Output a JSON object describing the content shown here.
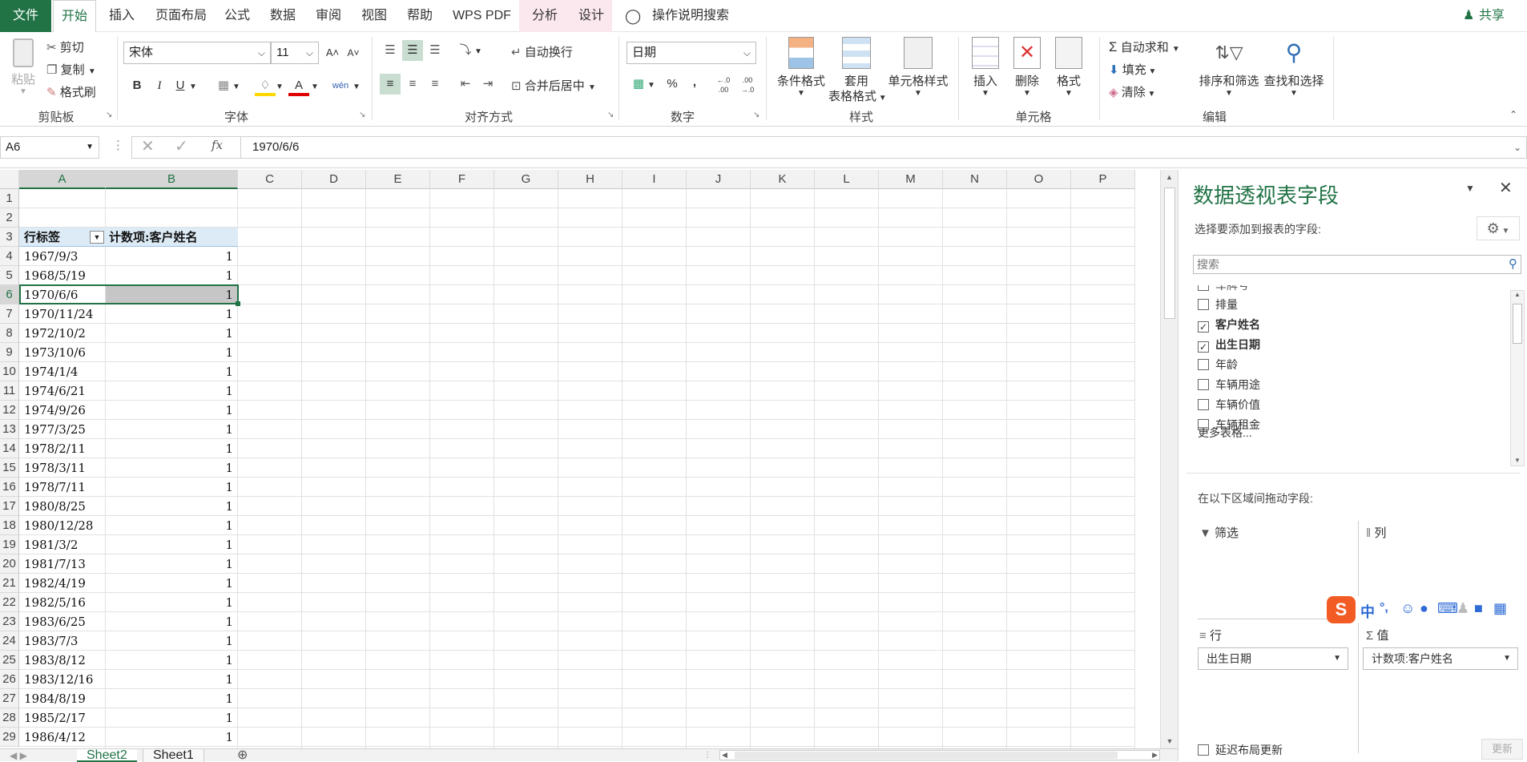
{
  "menubar": {
    "tabs": [
      "文件",
      "开始",
      "插入",
      "页面布局",
      "公式",
      "数据",
      "审阅",
      "视图",
      "帮助",
      "WPS PDF",
      "分析",
      "设计"
    ],
    "tell_me": "操作说明搜索",
    "share": "共享"
  },
  "ribbon": {
    "clipboard": {
      "paste": "粘贴",
      "cut": "剪切",
      "copy": "复制",
      "format_painter": "格式刷",
      "label": "剪贴板"
    },
    "font": {
      "name": "宋体",
      "size": "11",
      "label": "字体",
      "bold": "B",
      "italic": "I",
      "underline": "U",
      "font_color_glyph": "A",
      "grow": "A˄",
      "shrink": "A˅",
      "phonetic": "wén"
    },
    "alignment": {
      "wrap": "自动换行",
      "merge": "合并后居中",
      "label": "对齐方式"
    },
    "number": {
      "format": "日期",
      "percent": "%",
      "comma": ",",
      "inc_dec": "←.0 .00",
      "dec_dec": ".00 →.0",
      "label": "数字"
    },
    "styles": {
      "conditional": "条件格式",
      "table_fmt_1": "套用",
      "table_fmt_2": "表格格式",
      "cell_styles": "单元格样式",
      "label": "样式"
    },
    "cells": {
      "insert": "插入",
      "delete": "删除",
      "format": "格式",
      "label": "单元格"
    },
    "editing": {
      "autosum": "自动求和",
      "fill": "填充",
      "clear": "清除",
      "sort_filter": "排序和筛选",
      "find_select": "查找和选择",
      "label": "编辑"
    }
  },
  "formula_bar": {
    "name_box": "A6",
    "value": "1970/6/6",
    "fx": "fx"
  },
  "sheet": {
    "columns": [
      "A",
      "B",
      "C",
      "D",
      "E",
      "F",
      "G",
      "H",
      "I",
      "J",
      "K",
      "L",
      "M",
      "N",
      "O",
      "P"
    ],
    "rows": [
      "1",
      "2",
      "3",
      "4",
      "5",
      "6",
      "7",
      "8",
      "9",
      "10",
      "11",
      "12",
      "13",
      "14",
      "15",
      "16",
      "17",
      "18",
      "19",
      "20",
      "21",
      "22",
      "23",
      "24",
      "25",
      "26",
      "27",
      "28",
      "29"
    ],
    "header_a": "行标签",
    "header_b": "计数项:客户姓名",
    "data_rows": [
      {
        "date": "1967/9/3",
        "count": "1"
      },
      {
        "date": "1968/5/19",
        "count": "1"
      },
      {
        "date": "1970/6/6",
        "count": "1"
      },
      {
        "date": "1970/11/24",
        "count": "1"
      },
      {
        "date": "1972/10/2",
        "count": "1"
      },
      {
        "date": "1973/10/6",
        "count": "1"
      },
      {
        "date": "1974/1/4",
        "count": "1"
      },
      {
        "date": "1974/6/21",
        "count": "1"
      },
      {
        "date": "1974/9/26",
        "count": "1"
      },
      {
        "date": "1977/3/25",
        "count": "1"
      },
      {
        "date": "1978/2/11",
        "count": "1"
      },
      {
        "date": "1978/3/11",
        "count": "1"
      },
      {
        "date": "1978/7/11",
        "count": "1"
      },
      {
        "date": "1980/8/25",
        "count": "1"
      },
      {
        "date": "1980/12/28",
        "count": "1"
      },
      {
        "date": "1981/3/2",
        "count": "1"
      },
      {
        "date": "1981/7/13",
        "count": "1"
      },
      {
        "date": "1982/4/19",
        "count": "1"
      },
      {
        "date": "1982/5/16",
        "count": "1"
      },
      {
        "date": "1983/6/25",
        "count": "1"
      },
      {
        "date": "1983/7/3",
        "count": "1"
      },
      {
        "date": "1983/8/12",
        "count": "1"
      },
      {
        "date": "1983/12/16",
        "count": "1"
      },
      {
        "date": "1984/8/19",
        "count": "1"
      },
      {
        "date": "1985/2/17",
        "count": "1"
      },
      {
        "date": "1986/4/12",
        "count": "1"
      }
    ]
  },
  "sheet_tabs": [
    "Sheet2",
    "Sheet1"
  ],
  "pivot_pane": {
    "title": "数据透视表字段",
    "subtitle": "选择要添加到报表的字段:",
    "search_placeholder": "搜索",
    "partial_field": "车牌号",
    "fields": [
      {
        "label": "排量",
        "checked": false
      },
      {
        "label": "客户姓名",
        "checked": true
      },
      {
        "label": "出生日期",
        "checked": true
      },
      {
        "label": "年龄",
        "checked": false
      },
      {
        "label": "车辆用途",
        "checked": false
      },
      {
        "label": "车辆价值",
        "checked": false
      },
      {
        "label": "车辆租金",
        "checked": false
      }
    ],
    "more_tables": "更多表格...",
    "drag_hint": "在以下区域间拖动字段:",
    "filter_label": "筛选",
    "columns_label": "列",
    "rows_label": "行",
    "values_label": "值",
    "rows_field": "出生日期",
    "values_field": "计数项:客户姓名",
    "defer_update": "延迟布局更新",
    "update": "更新"
  },
  "ime": {
    "lang": "中",
    "punct": "°,"
  },
  "colors": {
    "accent": "#217346",
    "context_tab": "#fbe8ee",
    "selection": "#c6c6c6",
    "pivot_header": "#ddebf7"
  }
}
